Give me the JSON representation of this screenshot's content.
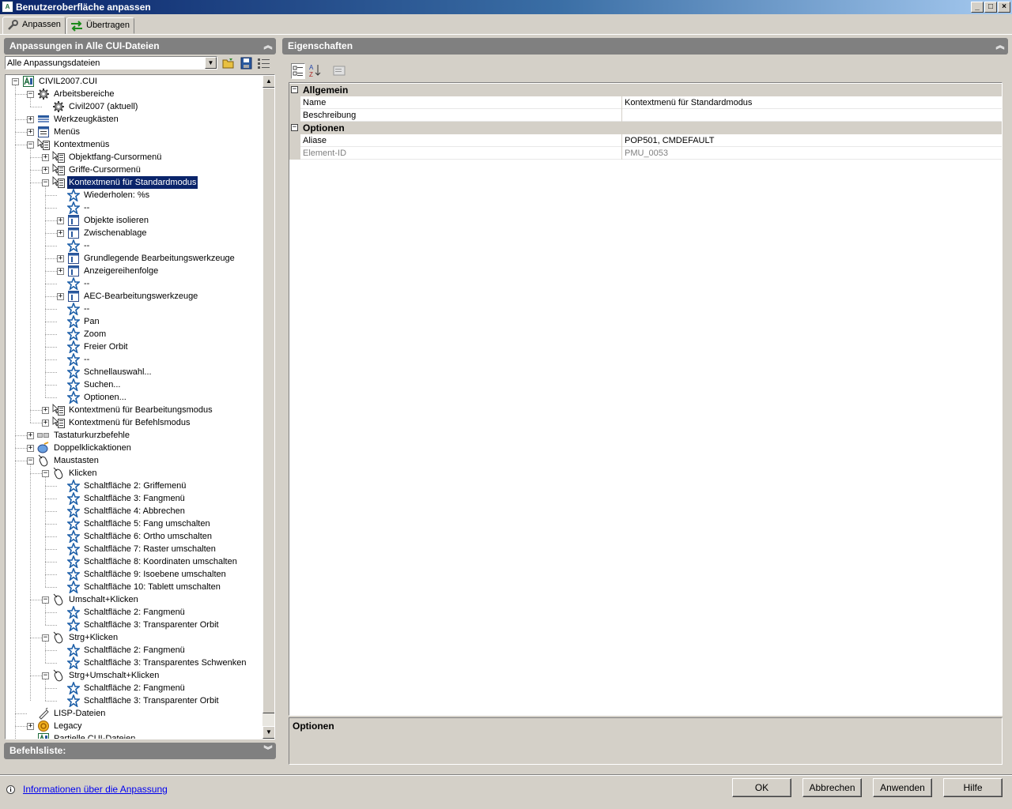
{
  "window": {
    "title": "Benutzeroberfläche anpassen"
  },
  "tabs": [
    {
      "label": "Anpassen",
      "active": true
    },
    {
      "label": "Übertragen",
      "active": false
    }
  ],
  "left_panel": {
    "title": "Anpassungen in Alle CUI-Dateien",
    "combo_value": "Alle Anpassungsdateien",
    "tree": [
      {
        "label": "CIVIL2007.CUI",
        "icon": "cui-file-icon",
        "expander": "-"
      },
      {
        "label": "Arbeitsbereiche",
        "icon": "gear-icon",
        "expander": "-"
      },
      {
        "label": "Civil2007 (aktuell)",
        "icon": "gear-icon",
        "expander": ""
      },
      {
        "label": "Werkzeugkästen",
        "icon": "toolbar-icon",
        "expander": "+"
      },
      {
        "label": "Menüs",
        "icon": "menu-icon",
        "expander": "+"
      },
      {
        "label": "Kontextmenüs",
        "icon": "context-menu-icon",
        "expander": "-"
      },
      {
        "label": "Objektfang-Cursormenü",
        "icon": "context-menu-icon",
        "expander": "+"
      },
      {
        "label": "Griffe-Cursormenü",
        "icon": "context-menu-icon",
        "expander": "+"
      },
      {
        "label": "Kontextmenü für Standardmodus",
        "icon": "context-menu-icon",
        "expander": "-",
        "selected": true
      },
      {
        "label": "Wiederholen: %s",
        "icon": "command-star-icon",
        "expander": ""
      },
      {
        "label": "--",
        "icon": "command-star-icon",
        "expander": ""
      },
      {
        "label": "Objekte isolieren",
        "icon": "submenu-icon",
        "expander": "+"
      },
      {
        "label": "Zwischenablage",
        "icon": "submenu-icon",
        "expander": "+"
      },
      {
        "label": "--",
        "icon": "command-star-icon",
        "expander": ""
      },
      {
        "label": "Grundlegende Bearbeitungswerkzeuge",
        "icon": "submenu-icon",
        "expander": "+"
      },
      {
        "label": "Anzeigereihenfolge",
        "icon": "submenu-icon",
        "expander": "+"
      },
      {
        "label": "--",
        "icon": "command-star-icon",
        "expander": ""
      },
      {
        "label": "AEC-Bearbeitungswerkzeuge",
        "icon": "submenu-icon",
        "expander": "+"
      },
      {
        "label": "--",
        "icon": "command-star-icon",
        "expander": ""
      },
      {
        "label": "Pan",
        "icon": "command-star-icon",
        "expander": ""
      },
      {
        "label": "Zoom",
        "icon": "command-star-icon",
        "expander": ""
      },
      {
        "label": "Freier Orbit",
        "icon": "command-star-icon",
        "expander": ""
      },
      {
        "label": "--",
        "icon": "command-star-icon",
        "expander": ""
      },
      {
        "label": "Schnellauswahl...",
        "icon": "command-star-icon",
        "expander": ""
      },
      {
        "label": "Suchen...",
        "icon": "command-star-icon",
        "expander": ""
      },
      {
        "label": "Optionen...",
        "icon": "command-star-icon",
        "expander": ""
      },
      {
        "label": "Kontextmenü für Bearbeitungsmodus",
        "icon": "context-menu-icon",
        "expander": "+"
      },
      {
        "label": "Kontextmenü für Befehlsmodus",
        "icon": "context-menu-icon",
        "expander": "+"
      },
      {
        "label": "Tastaturkurzbefehle",
        "icon": "keyboard-icon",
        "expander": "+"
      },
      {
        "label": "Doppelklickaktionen",
        "icon": "double-click-icon",
        "expander": "+"
      },
      {
        "label": "Maustasten",
        "icon": "mouse-icon",
        "expander": "-"
      },
      {
        "label": "Klicken",
        "icon": "mouse-icon",
        "expander": "-"
      },
      {
        "label": "Schaltfläche 2: Griffemenü",
        "icon": "command-star-icon",
        "expander": ""
      },
      {
        "label": "Schaltfläche 3: Fangmenü",
        "icon": "command-star-icon",
        "expander": ""
      },
      {
        "label": "Schaltfläche 4: Abbrechen",
        "icon": "command-star-icon",
        "expander": ""
      },
      {
        "label": "Schaltfläche 5: Fang umschalten",
        "icon": "command-star-icon",
        "expander": ""
      },
      {
        "label": "Schaltfläche 6: Ortho umschalten",
        "icon": "command-star-icon",
        "expander": ""
      },
      {
        "label": "Schaltfläche 7: Raster umschalten",
        "icon": "command-star-icon",
        "expander": ""
      },
      {
        "label": "Schaltfläche 8: Koordinaten umschalten",
        "icon": "command-star-icon",
        "expander": ""
      },
      {
        "label": "Schaltfläche 9: Isoebene umschalten",
        "icon": "command-star-icon",
        "expander": ""
      },
      {
        "label": "Schaltfläche 10: Tablett umschalten",
        "icon": "command-star-icon",
        "expander": ""
      },
      {
        "label": "Umschalt+Klicken",
        "icon": "mouse-icon",
        "expander": "-"
      },
      {
        "label": "Schaltfläche 2: Fangmenü",
        "icon": "command-star-icon",
        "expander": ""
      },
      {
        "label": "Schaltfläche 3: Transparenter Orbit",
        "icon": "command-star-icon",
        "expander": ""
      },
      {
        "label": "Strg+Klicken",
        "icon": "mouse-icon",
        "expander": "-"
      },
      {
        "label": "Schaltfläche 2: Fangmenü",
        "icon": "command-star-icon",
        "expander": ""
      },
      {
        "label": "Schaltfläche 3: Transparentes Schwenken",
        "icon": "command-star-icon",
        "expander": ""
      },
      {
        "label": "Strg+Umschalt+Klicken",
        "icon": "mouse-icon",
        "expander": "-"
      },
      {
        "label": "Schaltfläche 2: Fangmenü",
        "icon": "command-star-icon",
        "expander": ""
      },
      {
        "label": "Schaltfläche 3: Transparenter Orbit",
        "icon": "command-star-icon",
        "expander": ""
      },
      {
        "label": "LISP-Dateien",
        "icon": "lisp-icon",
        "expander": ""
      },
      {
        "label": "Legacy",
        "icon": "legacy-icon",
        "expander": "+"
      },
      {
        "label": "Partielle CUI-Dateien",
        "icon": "cui-file-icon",
        "expander": ""
      }
    ]
  },
  "command_list": {
    "title": "Befehlsliste:"
  },
  "properties": {
    "title": "Eigenschaften",
    "categories": [
      {
        "name": "Allgemein",
        "rows": [
          {
            "name": "Name",
            "value": "Kontextmenü für Standardmodus"
          },
          {
            "name": "Beschreibung",
            "value": ""
          }
        ]
      },
      {
        "name": "Optionen",
        "rows": [
          {
            "name": "Aliase",
            "value": "POP501, CMDEFAULT"
          },
          {
            "name": "Element-ID",
            "value": "PMU_0053",
            "readonly": true
          }
        ]
      }
    ],
    "description_title": "Optionen"
  },
  "footer": {
    "info_link": "Informationen über die Anpassung",
    "buttons": {
      "ok": "OK",
      "cancel": "Abbrechen",
      "apply": "Anwenden",
      "help": "Hilfe"
    }
  },
  "colors": {
    "selection": "#0a246a",
    "panel_header": "#808080",
    "star_icon": "#1d5fa8"
  }
}
